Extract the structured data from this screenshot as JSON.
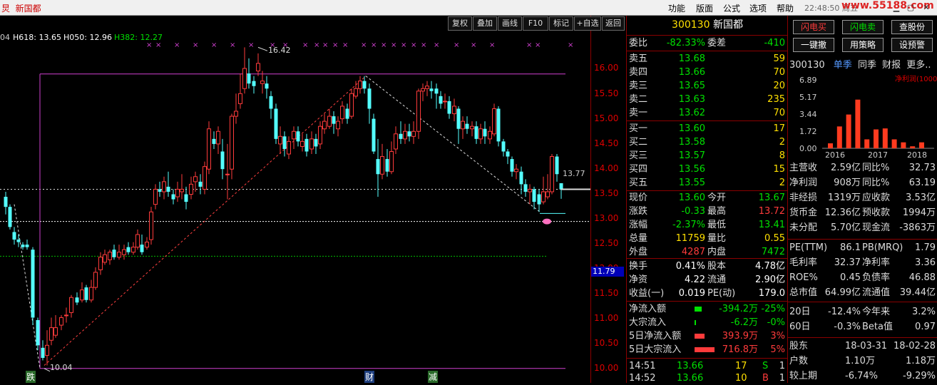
{
  "window": {
    "left_title": "新国都",
    "left_prefix": "炅",
    "clock": "22:48:50",
    "weekday": "周五",
    "watermark": "www.55188.com",
    "menu": [
      "功能",
      "版面",
      "公式",
      "选项",
      "帮助"
    ],
    "controls": [
      "▁",
      "▢",
      "✕"
    ]
  },
  "toolbar": {
    "buttons": [
      "复权",
      "叠加",
      "画线",
      "F10",
      "标记",
      "+自选",
      "返回"
    ]
  },
  "ma_legend": {
    "prefix": "04",
    "h618": "H618: 13.65",
    "h050": "H050: 12.96",
    "h382": "H382: 12.27"
  },
  "price_axis": {
    "labels": [
      "16.00",
      "15.50",
      "15.00",
      "14.50",
      "14.00",
      "13.50",
      "13.00",
      "12.50",
      "12.00",
      "11.50",
      "11.00",
      "10.50",
      "10.00"
    ],
    "current_tag": "11.79",
    "last_tag": "13.77"
  },
  "chart_marks": {
    "high": "16.42",
    "low": "10.04",
    "events": [
      "跌",
      "财",
      "减"
    ]
  },
  "quote": {
    "code": "300130",
    "name": "新国都",
    "wb_label": "委比",
    "wb_value": "-82.33%",
    "wc_label": "委差",
    "wc_value": "-410",
    "asks": [
      {
        "l": "卖五",
        "p": "13.68",
        "v": "59"
      },
      {
        "l": "卖四",
        "p": "13.66",
        "v": "70"
      },
      {
        "l": "卖三",
        "p": "13.65",
        "v": "20"
      },
      {
        "l": "卖二",
        "p": "13.63",
        "v": "235"
      },
      {
        "l": "卖一",
        "p": "13.62",
        "v": "70"
      }
    ],
    "bids": [
      {
        "l": "买一",
        "p": "13.60",
        "v": "17"
      },
      {
        "l": "买二",
        "p": "13.58",
        "v": "2"
      },
      {
        "l": "买三",
        "p": "13.57",
        "v": "8"
      },
      {
        "l": "买四",
        "p": "13.56",
        "v": "15"
      },
      {
        "l": "买五",
        "p": "13.55",
        "v": "2"
      }
    ],
    "stats": [
      {
        "l": "现价",
        "v": "13.60",
        "l2": "今开",
        "v2": "13.67"
      },
      {
        "l": "涨跌",
        "v": "-0.33",
        "l2": "最高",
        "v2": "13.72"
      },
      {
        "l": "涨幅",
        "v": "-2.37%",
        "l2": "最低",
        "v2": "13.41"
      },
      {
        "l": "总量",
        "v": "11759",
        "l2": "量比",
        "v2": "0.55"
      },
      {
        "l": "外盘",
        "v": "4287",
        "l2": "内盘",
        "v2": "7472"
      }
    ],
    "stats2": [
      {
        "l": "换手",
        "v": "0.41%",
        "l2": "股本",
        "v2": "4.78亿"
      },
      {
        "l": "净资",
        "v": "4.22",
        "l2": "流通",
        "v2": "2.90亿"
      },
      {
        "l": "收益(一)",
        "v": "0.019",
        "l2": "PE(动)",
        "v2": "179.0"
      }
    ],
    "flows": [
      {
        "l": "净流入额",
        "v": "-394.2万",
        "p": "-25%"
      },
      {
        "l": "大宗流入",
        "v": "-6.2万",
        "p": "-0%"
      },
      {
        "l": "5日净流入额",
        "v": "393.9万",
        "p": "3%"
      },
      {
        "l": "5日大宗流入",
        "v": "716.8万",
        "p": "5%"
      }
    ],
    "ticks": [
      {
        "t": "14:51",
        "p": "13.66",
        "v": "17",
        "s": "S",
        "n": "1"
      },
      {
        "t": "14:52",
        "p": "13.66",
        "v": "10",
        "s": "B",
        "n": "1"
      }
    ]
  },
  "fin": {
    "buttons": [
      "闪电买",
      "闪电卖",
      "查股份",
      "一键撤",
      "用策略",
      "设预警"
    ],
    "tabs": {
      "code": "300130",
      "t1": "单季",
      "t2": "同季",
      "t3": "财报",
      "t4": "更多.."
    },
    "bar_title": "净利润(1000万)",
    "y_labels": [
      "6.89",
      "5.17",
      "3.44",
      "1.72",
      "0.00"
    ],
    "x_labels": [
      "2016",
      "2017",
      "2018"
    ],
    "bars": [
      0.5,
      2.2,
      3.4,
      4.9,
      0.9,
      1.9,
      2.0,
      0.9,
      0.6,
      0.2,
      0.6
    ],
    "rows": [
      {
        "l": "主营收",
        "v": "2.59亿",
        "l2": "同比%",
        "v2": "32.73"
      },
      {
        "l": "净利润",
        "v": "908万",
        "l2": "同比%",
        "v2": "63.19"
      },
      {
        "l": "非经损",
        "v": "1319万",
        "l2": "应收款",
        "v2": "3.53亿"
      },
      {
        "l": "货币金",
        "v": "12.36亿",
        "l2": "预收款",
        "v2": "1994万"
      },
      {
        "l": "未分配",
        "v": "5.70亿",
        "l2": "现金流",
        "v2": "-3863万"
      }
    ],
    "rows2": [
      {
        "l": "PE(TTM)",
        "v": "86.1",
        "l2": "PB(MRQ)",
        "v2": "1.79"
      },
      {
        "l": "毛利率",
        "v": "32.37",
        "l2": "净利率",
        "v2": "3.36"
      },
      {
        "l": "ROE%",
        "v": "0.45",
        "l2": "负债率",
        "v2": "46.88"
      },
      {
        "l": "总市值",
        "v": "64.99亿",
        "l2": "流通值",
        "v2": "39.44亿"
      }
    ],
    "rows3": [
      {
        "l": "20日",
        "v": "-12.4%",
        "l2": "今年来",
        "v2": "3.2%"
      },
      {
        "l": "60日",
        "v": "-0.3%",
        "l2": "Beta值",
        "v2": "0.97"
      }
    ],
    "rows4": [
      {
        "l": "股东",
        "v": "18-03-31",
        "v2": "18-02-28"
      },
      {
        "l": "户数",
        "v": "1.10万",
        "v2": "1.18万"
      },
      {
        "l": "较上期",
        "v": "-6.74%",
        "v2": "-9.29%"
      }
    ]
  },
  "colors": {
    "up": "#ff3b3b",
    "down": "#00e000",
    "candle_down": "#54ffff",
    "candle_up": "#ff3b3b",
    "frame": "#8a0000",
    "magenta": "#d040d0"
  }
}
